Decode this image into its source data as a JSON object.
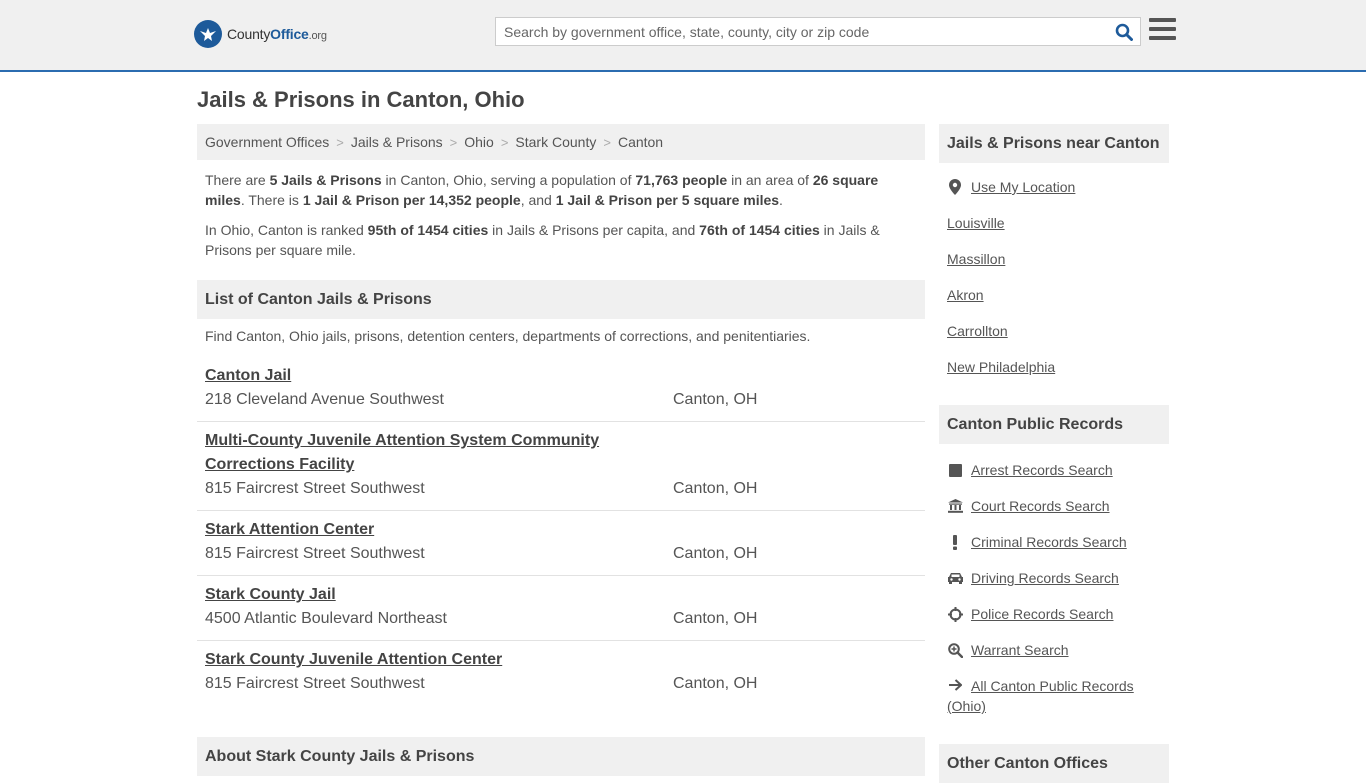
{
  "header": {
    "logo_county": "County",
    "logo_office": "Office",
    "logo_tld": ".org",
    "search_placeholder": "Search by government office, state, county, city or zip code"
  },
  "page_title": "Jails & Prisons in Canton, Ohio",
  "breadcrumb": [
    "Government Offices",
    "Jails & Prisons",
    "Ohio",
    "Stark County",
    "Canton"
  ],
  "intro": {
    "p1": [
      {
        "t": "There are ",
        "b": false
      },
      {
        "t": "5 Jails & Prisons",
        "b": true
      },
      {
        "t": " in Canton, Ohio, serving a population of ",
        "b": false
      },
      {
        "t": "71,763 people",
        "b": true
      },
      {
        "t": " in an area of ",
        "b": false
      },
      {
        "t": "26 square miles",
        "b": true
      },
      {
        "t": ". There is ",
        "b": false
      },
      {
        "t": "1 Jail & Prison per 14,352 people",
        "b": true
      },
      {
        "t": ", and ",
        "b": false
      },
      {
        "t": "1 Jail & Prison per 5 square miles",
        "b": true
      },
      {
        "t": ".",
        "b": false
      }
    ],
    "p2": [
      {
        "t": "In Ohio, Canton is ranked ",
        "b": false
      },
      {
        "t": "95th of 1454 cities",
        "b": true
      },
      {
        "t": " in Jails & Prisons per capita, and ",
        "b": false
      },
      {
        "t": "76th of 1454 cities",
        "b": true
      },
      {
        "t": " in Jails & Prisons per square mile.",
        "b": false
      }
    ]
  },
  "list_section": {
    "title": "List of Canton Jails & Prisons",
    "description": "Find Canton, Ohio jails, prisons, detention centers, departments of corrections, and penitentiaries."
  },
  "listings": [
    {
      "name": "Canton Jail",
      "address": "218 Cleveland Avenue Southwest",
      "city": "Canton, OH"
    },
    {
      "name": "Multi-County Juvenile Attention System Community Corrections Facility",
      "address": "815 Faircrest Street Southwest",
      "city": "Canton, OH"
    },
    {
      "name": "Stark Attention Center",
      "address": "815 Faircrest Street Southwest",
      "city": "Canton, OH"
    },
    {
      "name": "Stark County Jail",
      "address": "4500 Atlantic Boulevard Northeast",
      "city": "Canton, OH"
    },
    {
      "name": "Stark County Juvenile Attention Center",
      "address": "815 Faircrest Street Southwest",
      "city": "Canton, OH"
    }
  ],
  "about_section": {
    "title": "About Stark County Jails & Prisons"
  },
  "sidebar": {
    "near": {
      "title": "Jails & Prisons near Canton",
      "use_location": "Use My Location",
      "cities": [
        "Louisville",
        "Massillon",
        "Akron",
        "Carrollton",
        "New Philadelphia"
      ]
    },
    "records": {
      "title": "Canton Public Records",
      "items": [
        {
          "label": "Arrest Records Search",
          "icon": "square-icon"
        },
        {
          "label": "Court Records Search",
          "icon": "courthouse-icon"
        },
        {
          "label": "Criminal Records Search",
          "icon": "exclamation-icon"
        },
        {
          "label": "Driving Records Search",
          "icon": "car-icon"
        },
        {
          "label": "Police Records Search",
          "icon": "crosshair-icon"
        },
        {
          "label": "Warrant Search",
          "icon": "magnifier-plus-icon"
        }
      ],
      "all_link": "All Canton Public Records (Ohio)"
    },
    "other": {
      "title": "Other Canton Offices"
    }
  }
}
